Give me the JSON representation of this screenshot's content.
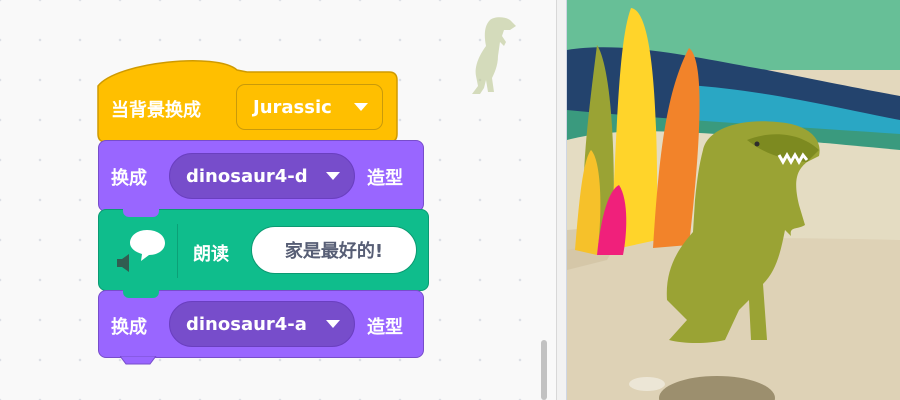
{
  "hat_block": {
    "label": "当背景换成",
    "backdrop_value": "Jurassic"
  },
  "costume_block_1": {
    "prefix": "换成",
    "costume_value": "dinosaur4-d",
    "suffix": "造型"
  },
  "speak_block": {
    "label": "朗读",
    "text_value": "家是最好的!"
  },
  "costume_block_2": {
    "prefix": "换成",
    "costume_value": "dinosaur4-a",
    "suffix": "造型"
  },
  "icons": [
    "dinosaur-sprite-icon",
    "speech-bubble-icon",
    "speaker-icon",
    "dropdown-caret-icon"
  ],
  "colors": {
    "events": "#ffbf00",
    "looks": "#9966ff",
    "text_to_speech": "#0fbd8c",
    "workspace": "#f9f9f9"
  }
}
